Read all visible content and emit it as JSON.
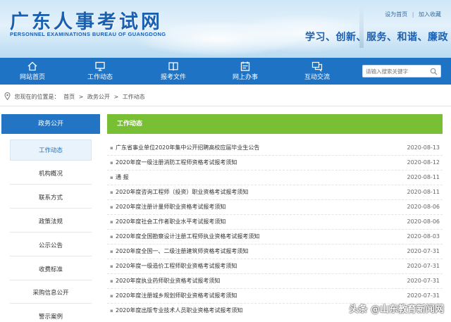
{
  "header": {
    "title": "广东人事考试网",
    "subtitle": "PERSONNEL EXAMINATIONS BUREAU OF GUANGDONG",
    "top_links": [
      "设为首页",
      "加入收藏"
    ],
    "slogan": "学习、创新、服务、和谐、廉政"
  },
  "nav": {
    "items": [
      {
        "label": "网站首页",
        "icon": "home-icon"
      },
      {
        "label": "工作动态",
        "icon": "monitor-icon"
      },
      {
        "label": "报考文件",
        "icon": "book-icon"
      },
      {
        "label": "网上办事",
        "icon": "calendar-icon"
      },
      {
        "label": "互动交流",
        "icon": "chat-icon"
      }
    ],
    "search_placeholder": "请输入搜索关键字"
  },
  "breadcrumb": {
    "prefix": "您现在的位置是：",
    "items": [
      "首页",
      "政务公开",
      "工作动态"
    ],
    "separator": ">"
  },
  "sidebar": {
    "heading": "政务公开",
    "items": [
      "工作动态",
      "机构概况",
      "联系方式",
      "政策法规",
      "公示公告",
      "收费标准",
      "采购信息公开",
      "警示案例"
    ],
    "active_index": 0
  },
  "main": {
    "heading": "工作动态",
    "news": [
      {
        "title": "广东省事业单位2020年集中公开招聘高校应届毕业生公告",
        "date": "2020-08-13"
      },
      {
        "title": "2020年度一级注册消防工程师资格考试报考须知",
        "date": "2020-08-12"
      },
      {
        "title": "通 报",
        "date": "2020-08-11"
      },
      {
        "title": "2020年度咨询工程师（投资）职业资格考试报考须知",
        "date": "2020-08-11"
      },
      {
        "title": "2020年度注册计量师职业资格考试报考须知",
        "date": "2020-08-06"
      },
      {
        "title": "2020年度社会工作者职业水平考试报考须知",
        "date": "2020-08-06"
      },
      {
        "title": "2020年度全国勘察设计注册工程师执业资格考试报考须知",
        "date": "2020-08-03"
      },
      {
        "title": "2020年度全国一、二级注册建筑师资格考试报考须知",
        "date": "2020-07-31"
      },
      {
        "title": "2020年度一级造价工程师职业资格考试报考须知",
        "date": "2020-07-31"
      },
      {
        "title": "2020年度执业药师职业资格考试报考须知",
        "date": "2020-07-31"
      },
      {
        "title": "2020年度注册城乡规划师职业资格考试报考须知",
        "date": "2020-07-31"
      },
      {
        "title": "2020年度出版专业技术人员职业资格考试报考须知",
        "date": ""
      }
    ]
  },
  "watermark": "头条 @山东教育新闻网",
  "colors": {
    "brand_blue": "#1f73c5",
    "title_blue": "#1b5fb1",
    "accent_green": "#79bf34"
  }
}
